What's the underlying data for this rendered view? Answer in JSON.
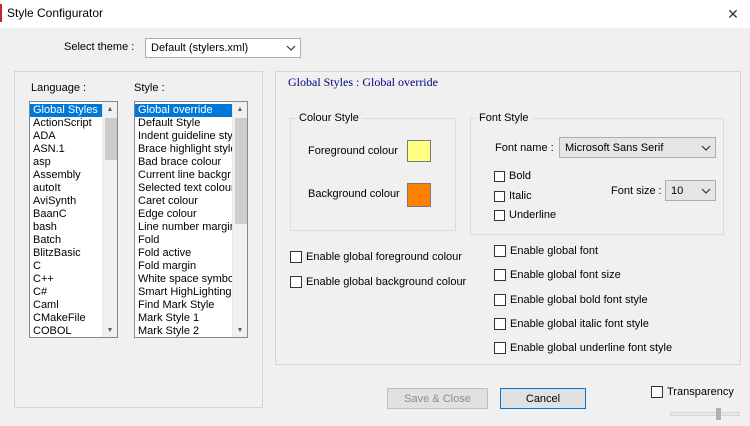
{
  "window": {
    "title": "Style Configurator",
    "close_glyph": "✕"
  },
  "theme": {
    "label": "Select theme :",
    "value": "Default (stylers.xml)"
  },
  "language": {
    "label": "Language :",
    "items": [
      "Global Styles",
      "ActionScript",
      "ADA",
      "ASN.1",
      "asp",
      "Assembly",
      "autoIt",
      "AviSynth",
      "BaanC",
      "bash",
      "Batch",
      "BlitzBasic",
      "C",
      "C++",
      "C#",
      "Caml",
      "CMakeFile",
      "COBOL"
    ],
    "selected_index": 0
  },
  "style": {
    "label": "Style :",
    "items": [
      "Global override",
      "Default Style",
      "Indent guideline sty",
      "Brace highlight style",
      "Bad brace colour",
      "Current line backgr",
      "Selected text colour",
      "Caret colour",
      "Edge colour",
      "Line number margin",
      "Fold",
      "Fold active",
      "Fold margin",
      "White space symbo",
      "Smart HighLighting",
      "Find Mark Style",
      "Mark Style 1",
      "Mark Style 2"
    ],
    "selected_index": 0
  },
  "header": {
    "text": "Global Styles : Global override",
    "color": "#000080"
  },
  "colour_style": {
    "title": "Colour Style",
    "foreground_label": "Foreground colour",
    "foreground_color": "#ffff80",
    "background_label": "Background colour",
    "background_color": "#ff8000"
  },
  "font_style": {
    "title": "Font Style",
    "font_name_label": "Font name :",
    "font_name_value": "Microsoft Sans Serif",
    "bold_label": "Bold",
    "italic_label": "Italic",
    "underline_label": "Underline",
    "font_size_label": "Font size :",
    "font_size_value": "10"
  },
  "enable_left": {
    "global_fg": "Enable global foreground colour",
    "global_bg": "Enable global background colour"
  },
  "enable_right": {
    "global_font": "Enable global font",
    "global_font_size": "Enable global font size",
    "global_bold": "Enable global bold font style",
    "global_italic": "Enable global italic font style",
    "global_underline": "Enable global underline font style"
  },
  "buttons": {
    "save_close": "Save & Close",
    "cancel": "Cancel"
  },
  "transparency": {
    "label": "Transparency",
    "level_percent": 72
  },
  "icons": {
    "dropdown": "chevron-down-icon",
    "scroll_up": "triangle-up-icon",
    "scroll_down": "triangle-down-icon"
  },
  "scroll_glyphs": {
    "up": "▲",
    "down": "▼",
    "dropdown": "⌵"
  }
}
